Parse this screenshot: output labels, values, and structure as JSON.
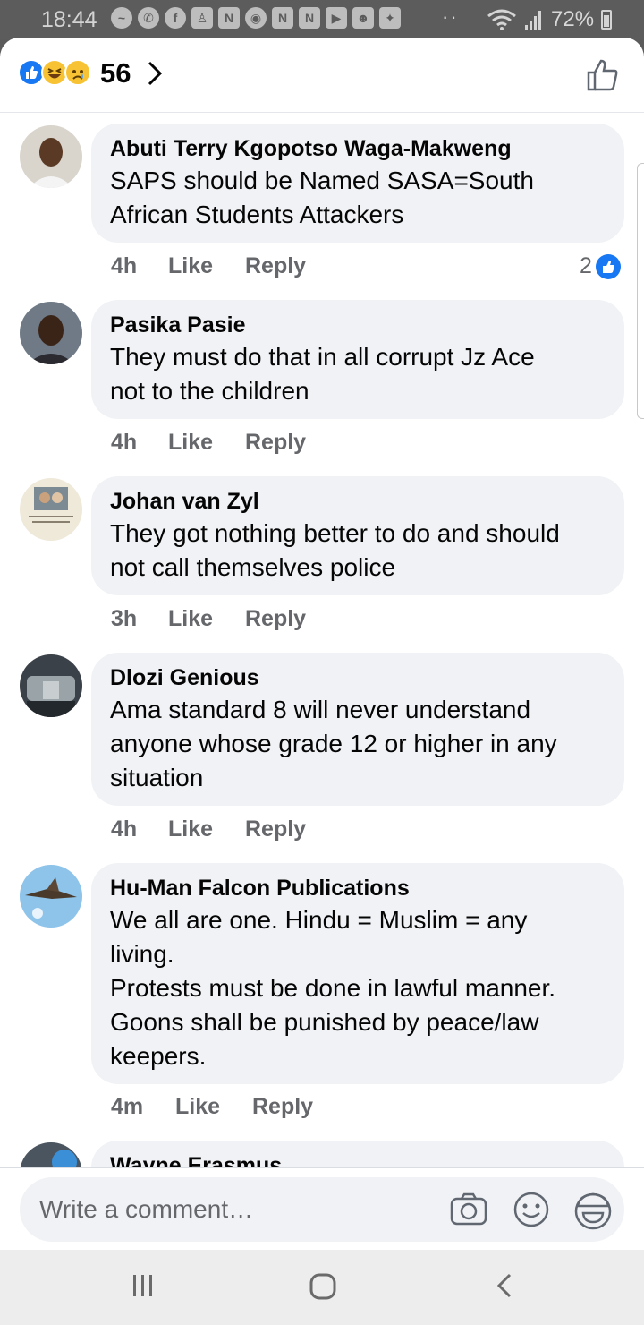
{
  "status_bar": {
    "time": "18:44",
    "battery": "72%",
    "notification_icons": [
      "messenger-icon",
      "whatsapp-icon",
      "facebook-icon",
      "person-icon",
      "n-icon",
      "camera-icon",
      "n-icon",
      "n-icon",
      "youtube-icon",
      "snapchat-icon",
      "twitter-icon"
    ],
    "more_dots": "··"
  },
  "reactions": {
    "types": [
      "like",
      "haha",
      "sad"
    ],
    "count": "56"
  },
  "comments": [
    {
      "author": "Abuti Terry Kgopotso Waga-Makweng",
      "lines": [
        "SAPS should be Named SASA=South",
        "African Students Attackers"
      ],
      "time": "4h",
      "like": "Like",
      "reply": "Reply",
      "reactions_count": "2"
    },
    {
      "author": "Pasika Pasie",
      "lines": [
        "They must do that in all corrupt Jz Ace",
        "not to the children"
      ],
      "time": "4h",
      "like": "Like",
      "reply": "Reply"
    },
    {
      "author": "Johan van Zyl",
      "lines": [
        "They got nothing better to do and should",
        "not call themselves police"
      ],
      "time": "3h",
      "like": "Like",
      "reply": "Reply"
    },
    {
      "author": "Dlozi Genious",
      "lines": [
        "Ama standard 8 will never understand",
        "anyone whose grade 12 or higher in any",
        "situation"
      ],
      "time": "4h",
      "like": "Like",
      "reply": "Reply"
    },
    {
      "author": "Hu-Man Falcon Publications",
      "lines": [
        "We all are one. Hindu = Muslim = any",
        "living.",
        "Protests must be done in lawful manner.",
        "Goons shall be punished by peace/law",
        "keepers."
      ],
      "time": "4m",
      "like": "Like",
      "reply": "Reply"
    },
    {
      "author": "Wayne Erasmus",
      "lines": []
    }
  ],
  "composer": {
    "placeholder": "Write a comment…"
  },
  "colors": {
    "facebook_blue": "#1877f2",
    "bubble": "#f0f2f5",
    "meta_gray": "#65676b"
  }
}
